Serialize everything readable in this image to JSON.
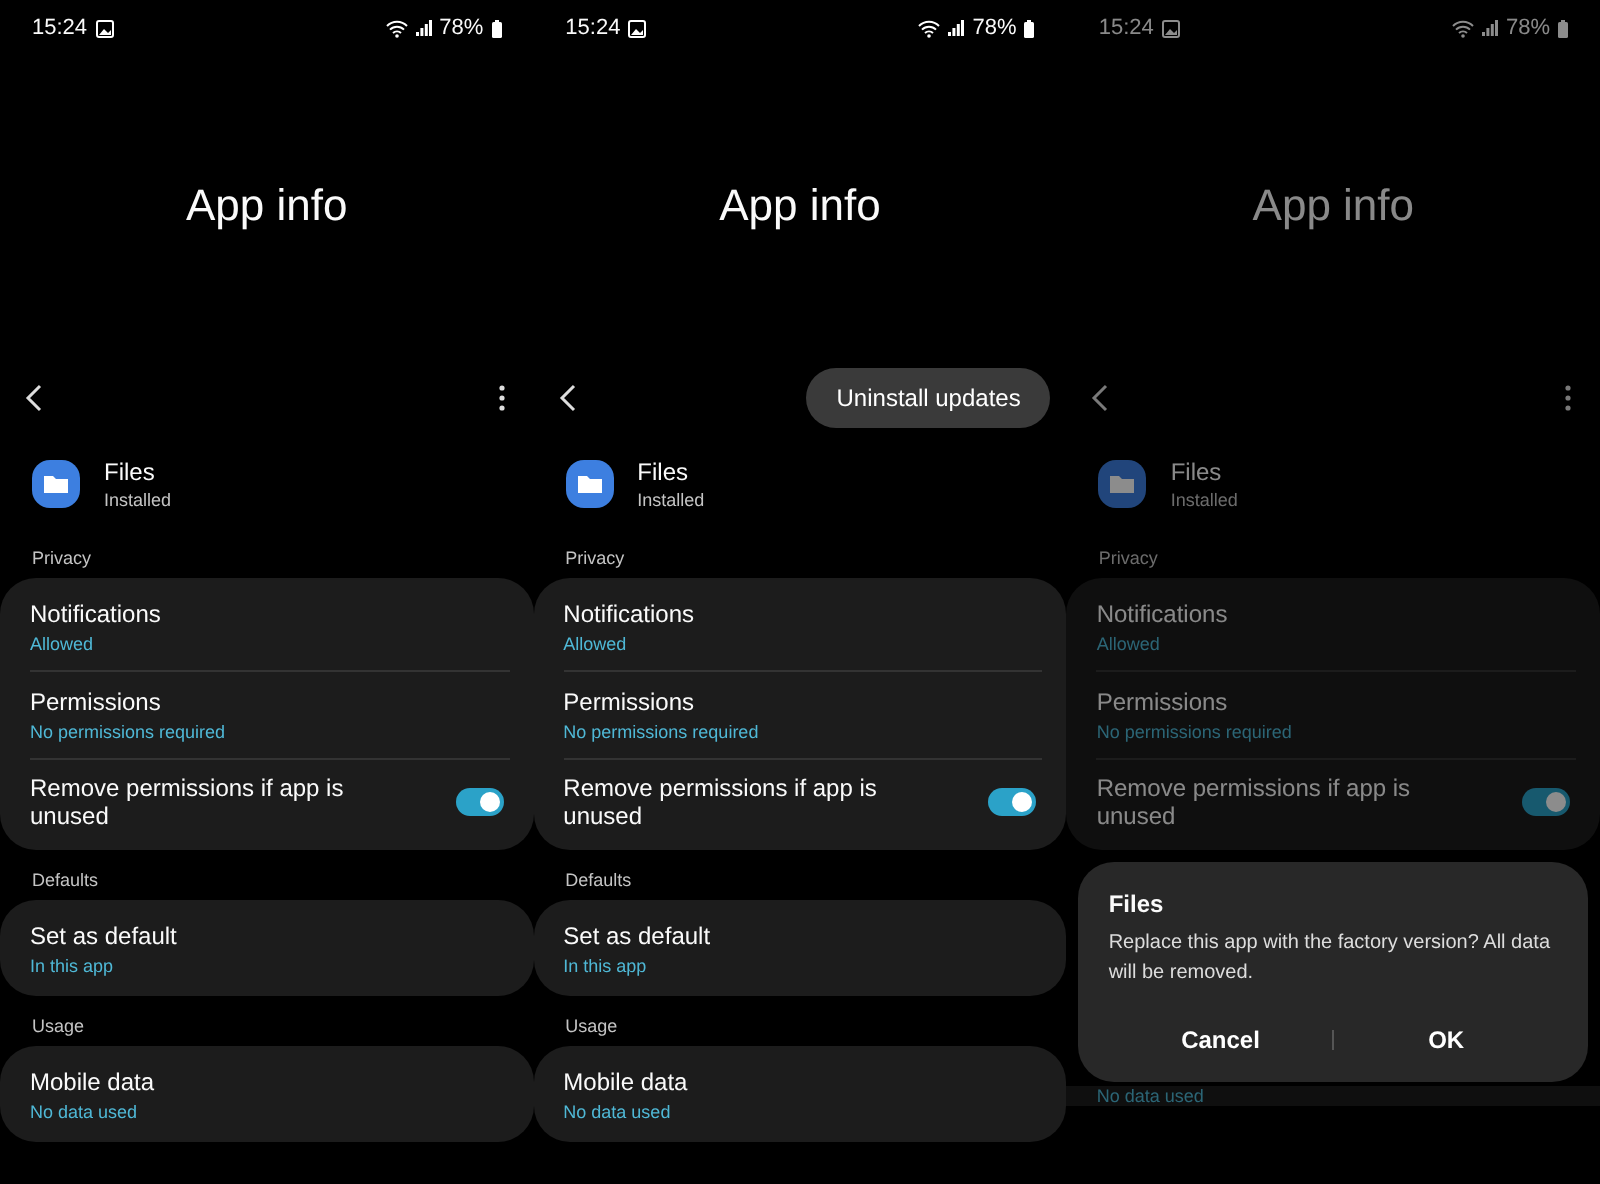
{
  "screens": [
    {
      "dimmed": false,
      "status_bar": {
        "time": "15:24",
        "battery": "78%"
      },
      "title": "App info",
      "toolbar": {
        "menu": {
          "kind": "more"
        }
      },
      "app": {
        "name": "Files",
        "status": "Installed"
      },
      "sections": [
        {
          "label": "Privacy",
          "items": [
            {
              "kind": "link",
              "title": "Notifications",
              "subtitle": "Allowed"
            },
            {
              "kind": "link",
              "title": "Permissions",
              "subtitle": "No permissions required"
            },
            {
              "kind": "switch",
              "title": "Remove permissions if app is unused",
              "on": true
            }
          ]
        },
        {
          "label": "Defaults",
          "items": [
            {
              "kind": "link",
              "title": "Set as default",
              "subtitle": "In this app"
            }
          ]
        },
        {
          "label": "Usage",
          "items": [
            {
              "kind": "link",
              "title": "Mobile data",
              "subtitle": "No data used"
            }
          ]
        }
      ]
    },
    {
      "dimmed": false,
      "status_bar": {
        "time": "15:24",
        "battery": "78%"
      },
      "title": "App info",
      "toolbar": {
        "menu": {
          "kind": "popup",
          "label": "Uninstall updates"
        }
      },
      "app": {
        "name": "Files",
        "status": "Installed"
      },
      "sections": [
        {
          "label": "Privacy",
          "items": [
            {
              "kind": "link",
              "title": "Notifications",
              "subtitle": "Allowed"
            },
            {
              "kind": "link",
              "title": "Permissions",
              "subtitle": "No permissions required"
            },
            {
              "kind": "switch",
              "title": "Remove permissions if app is unused",
              "on": true
            }
          ]
        },
        {
          "label": "Defaults",
          "items": [
            {
              "kind": "link",
              "title": "Set as default",
              "subtitle": "In this app"
            }
          ]
        },
        {
          "label": "Usage",
          "items": [
            {
              "kind": "link",
              "title": "Mobile data",
              "subtitle": "No data used"
            }
          ]
        }
      ]
    },
    {
      "dimmed": true,
      "status_bar": {
        "time": "15:24",
        "battery": "78%"
      },
      "title": "App info",
      "toolbar": {
        "menu": {
          "kind": "more"
        }
      },
      "app": {
        "name": "Files",
        "status": "Installed"
      },
      "sections": [
        {
          "label": "Privacy",
          "items": [
            {
              "kind": "link",
              "title": "Notifications",
              "subtitle": "Allowed"
            },
            {
              "kind": "link",
              "title": "Permissions",
              "subtitle": "No permissions required"
            },
            {
              "kind": "switch",
              "title": "Remove permissions if app is unused",
              "on": true
            }
          ]
        }
      ],
      "dialog": {
        "title": "Files",
        "message": "Replace this app with the factory version? All data will be removed.",
        "buttons": [
          "Cancel",
          "OK"
        ]
      },
      "below_dialog": {
        "items": [
          {
            "kind": "link",
            "subtitle": "No data used"
          }
        ]
      }
    }
  ]
}
